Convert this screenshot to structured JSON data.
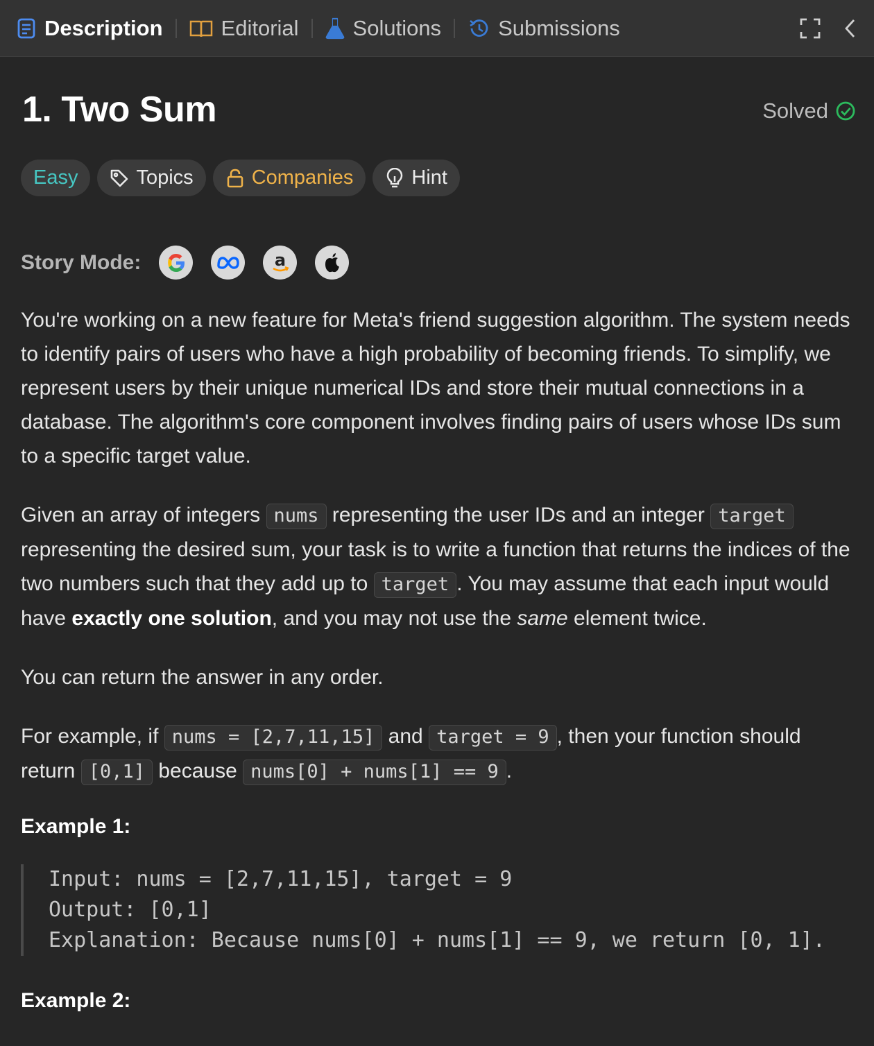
{
  "tabs": [
    {
      "label": "Description",
      "icon": "description-icon",
      "active": true
    },
    {
      "label": "Editorial",
      "icon": "book-icon"
    },
    {
      "label": "Solutions",
      "icon": "flask-icon"
    },
    {
      "label": "Submissions",
      "icon": "history-icon"
    }
  ],
  "problem": {
    "title": "1. Two Sum",
    "status": "Solved"
  },
  "badges": {
    "difficulty": "Easy",
    "topics": "Topics",
    "companies": "Companies",
    "hint": "Hint"
  },
  "story": {
    "label": "Story Mode:",
    "companies": [
      "google",
      "meta",
      "amazon",
      "apple"
    ]
  },
  "paragraphs": {
    "p1": "You're working on a new feature for Meta's friend suggestion algorithm. The system needs to identify pairs of users who have a high probability of becoming friends. To simplify, we represent users by their unique numerical IDs and store their mutual connections in a database. The algorithm's core component involves finding pairs of users whose IDs sum to a specific target value.",
    "p2": {
      "t1": "Given an array of integers ",
      "c1": "nums",
      "t2": " representing the user IDs and an integer ",
      "c2": "target",
      "t3": " representing the desired sum, your task is to write a function that returns the indices of the two numbers such that they add up to ",
      "c3": "target",
      "t4": ". You may assume that each input would have ",
      "b1": "exactly one solution",
      "t5": ", and you may not use the ",
      "i1": "same",
      "t6": " element twice."
    },
    "p3": "You can return the answer in any order.",
    "p4": {
      "t1": "For example, if ",
      "c1": "nums = [2,7,11,15]",
      "t2": " and ",
      "c2": "target = 9",
      "t3": ", then your function should return ",
      "c3": "[0,1]",
      "t4": " because ",
      "c4": "nums[0] + nums[1] == 9",
      "t5": "."
    }
  },
  "examples": [
    {
      "title": "Example 1:",
      "input": "Input: nums = [2,7,11,15], target = 9",
      "output": "Output: [0,1]",
      "explanation": "Explanation: Because nums[0] + nums[1] == 9, we return [0, 1]."
    },
    {
      "title": "Example 2:"
    }
  ],
  "colors": {
    "background": "#262626",
    "tabbar": "#333333",
    "easy": "#46c6c2",
    "companies": "#f0b34a",
    "solved_check": "#2cbb5d",
    "tab_icon_blue": "#3a7bd5"
  }
}
